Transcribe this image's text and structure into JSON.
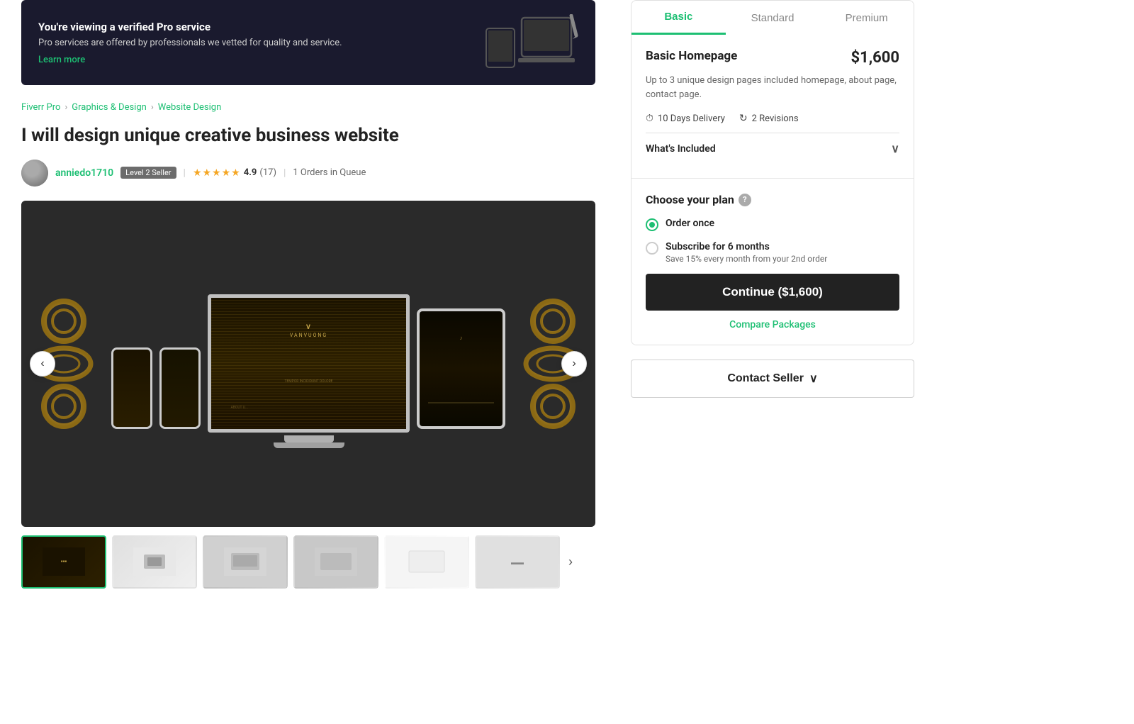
{
  "banner": {
    "headline": "You're viewing a verified Pro service",
    "subtext": "Pro services are offered by professionals we vetted for quality and service.",
    "learn_more": "Learn more"
  },
  "breadcrumb": {
    "items": [
      "Fiverr Pro",
      "Graphics & Design",
      "Website Design"
    ]
  },
  "listing": {
    "title": "I will design unique creative business website",
    "seller": {
      "username": "anniedo1710",
      "badge": "Level 2 Seller",
      "rating": "4.9",
      "review_count": "(17)",
      "orders_in_queue": "1 Orders in Queue"
    }
  },
  "tabs": {
    "basic": "Basic",
    "standard": "Standard",
    "premium": "Premium"
  },
  "package": {
    "name": "Basic Homepage",
    "price": "$1,600",
    "description": "Up to 3 unique design pages included homepage, about page, contact page.",
    "delivery": "10 Days Delivery",
    "revisions": "2 Revisions",
    "whats_included": "What's Included"
  },
  "plan": {
    "title": "Choose your plan",
    "order_once_label": "Order once",
    "subscribe_label": "Subscribe for 6 months",
    "subscribe_sublabel": "Save 15% every month from your 2nd order"
  },
  "buttons": {
    "continue": "Continue ($1,600)",
    "compare": "Compare Packages",
    "contact_seller": "Contact Seller"
  },
  "thumbnails": [
    {
      "id": 1,
      "active": true
    },
    {
      "id": 2,
      "active": false
    },
    {
      "id": 3,
      "active": false
    },
    {
      "id": 4,
      "active": false
    },
    {
      "id": 5,
      "active": false
    },
    {
      "id": 6,
      "active": false
    }
  ]
}
